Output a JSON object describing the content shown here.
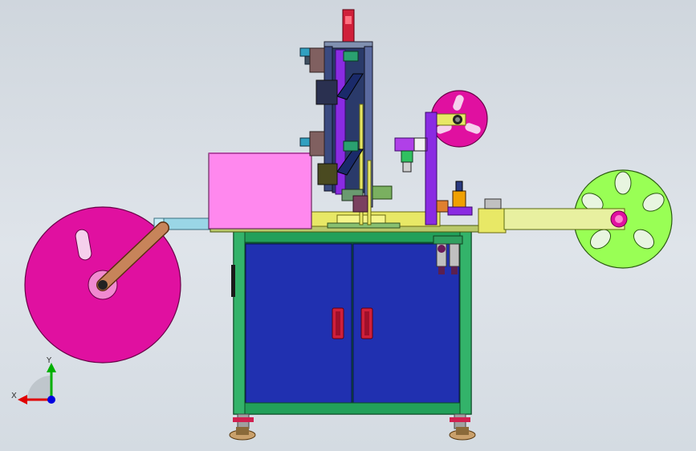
{
  "view": {
    "background_top": "#cfd6dd",
    "background_bottom": "#d4dbe2"
  },
  "triad": {
    "x_label": "X",
    "y_label": "Y",
    "x_color": "#e00000",
    "y_color": "#00b000",
    "z_color": "#0000e0"
  },
  "colors": {
    "cabinet_frame": "#22a05a",
    "cabinet_door": "#2030b0",
    "door_handle": "#d0203a",
    "left_reel": "#e010a0",
    "right_reel": "#99ff55",
    "top_reel": "#e010a0",
    "pink_box": "#ff88ee",
    "purple_parts": "#8a2be2",
    "yellow_parts": "#e8e866",
    "navy_parts": "#1a2a6a"
  }
}
